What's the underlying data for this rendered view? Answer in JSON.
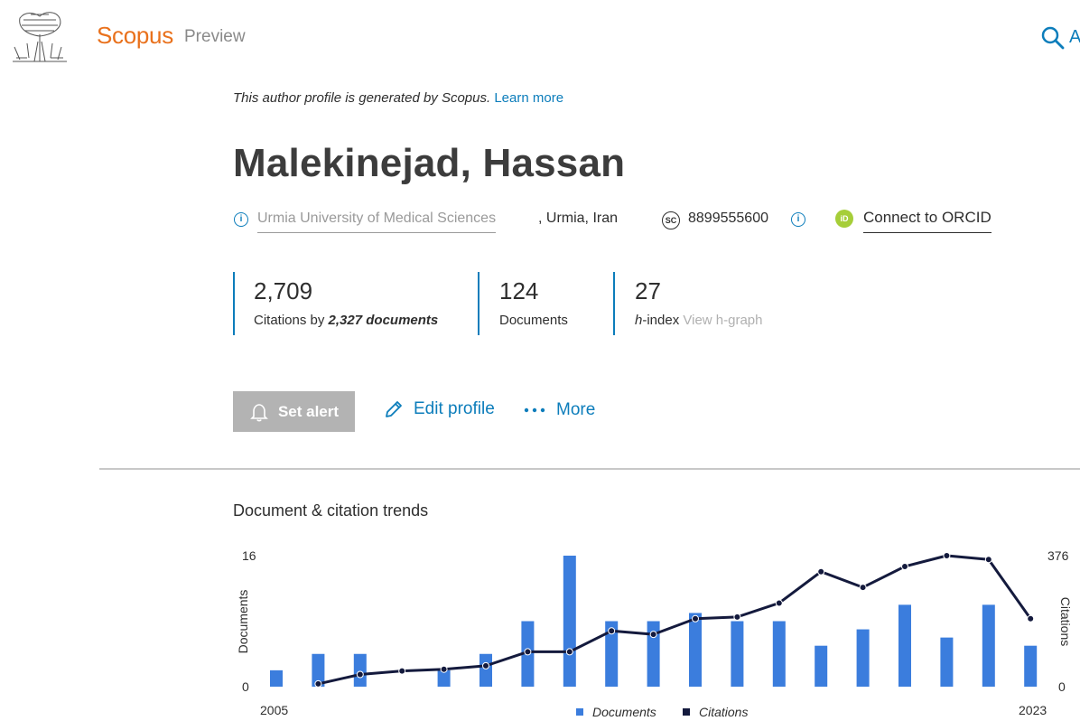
{
  "header": {
    "brand": "Scopus",
    "brand_suffix": "Preview",
    "cut_text": "A",
    "icons": [
      "elsevier-logo",
      "search-icon"
    ]
  },
  "profile": {
    "note_text": "This author profile is generated by Scopus.",
    "note_link": "Learn more",
    "name": "Malekinejad, Hassan",
    "affiliation": "Urmia University of Medical Sciences",
    "location": ", Urmia, Iran",
    "author_id": "8899555600",
    "sc_badge": "SC",
    "orcid_badge": "iD",
    "orcid_link": "Connect to ORCID"
  },
  "metrics": {
    "citations_value": "2,709",
    "citations_label_prefix": "Citations by",
    "citations_label_docs": "2,327 documents",
    "documents_value": "124",
    "documents_label": "Documents",
    "hindex_value": "27",
    "hindex_label_h": "h",
    "hindex_label_rest": "-index",
    "hgraph_link": "View h-graph"
  },
  "actions": {
    "set_alert": "Set alert",
    "edit_profile": "Edit profile",
    "more": "More"
  },
  "trends": {
    "title": "Document & citation trends"
  },
  "colors": {
    "accent": "#0c7dbb",
    "brand": "#e9711c",
    "bars": "#3b7ddd",
    "line": "#141a3d",
    "orcid": "#a6ce39"
  },
  "chart_data": {
    "type": "bar",
    "x": [
      2005,
      2006,
      2007,
      2008,
      2009,
      2010,
      2011,
      2012,
      2013,
      2014,
      2015,
      2016,
      2017,
      2018,
      2019,
      2020,
      2021,
      2022,
      2023
    ],
    "x_tick_labels": [
      "2005",
      "2023"
    ],
    "series": [
      {
        "name": "Documents",
        "type": "bar",
        "axis": "left",
        "values": [
          2,
          4,
          4,
          0,
          2,
          4,
          8,
          16,
          8,
          8,
          9,
          8,
          8,
          5,
          7,
          10,
          6,
          10,
          5
        ]
      },
      {
        "name": "Citations",
        "type": "line",
        "axis": "right",
        "x": [
          2006,
          2007,
          2008,
          2009,
          2010,
          2011,
          2012,
          2013,
          2014,
          2015,
          2016,
          2017,
          2018,
          2019,
          2020,
          2021,
          2022,
          2023
        ],
        "values": [
          8,
          35,
          45,
          50,
          60,
          100,
          100,
          160,
          150,
          195,
          200,
          240,
          330,
          285,
          345,
          376,
          365,
          195
        ]
      }
    ],
    "y_left": {
      "label": "Documents",
      "ylim": [
        0,
        16
      ],
      "ticks": [
        "0",
        "16"
      ]
    },
    "y_right": {
      "label": "Citations",
      "ylim": [
        0,
        376
      ],
      "ticks": [
        "0",
        "376"
      ]
    },
    "legend": {
      "placement": "bottom"
    }
  }
}
